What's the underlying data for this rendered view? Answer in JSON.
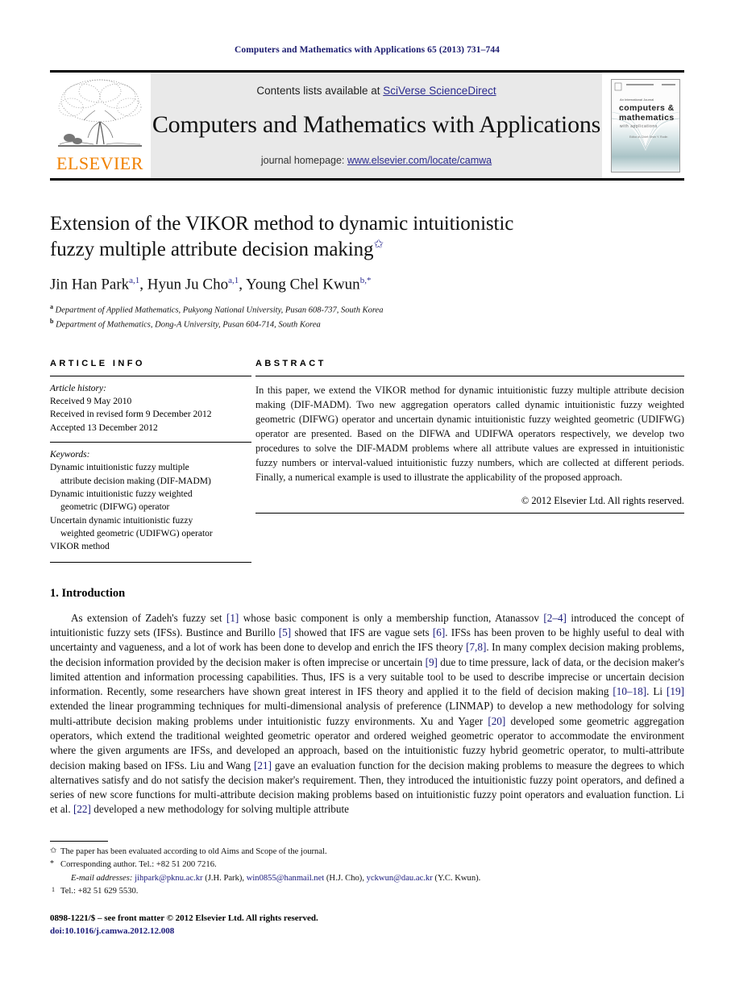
{
  "running_head": "Computers and Mathematics with Applications 65 (2013) 731–744",
  "masthead": {
    "publisher_word": "ELSEVIER",
    "contents_prefix": "Contents lists available at ",
    "contents_link": "SciVerse ScienceDirect",
    "journal_title": "Computers and Mathematics with Applications",
    "homepage_prefix": "journal homepage: ",
    "homepage_link": "www.elsevier.com/locate/camwa",
    "cover": {
      "top_label": "An International Journal",
      "line1": "computers &",
      "line2": "mathematics",
      "line3": "with applications",
      "editor": "Editor-in-Chief: Ervin Y. Rodin"
    }
  },
  "title": {
    "line1": "Extension of the VIKOR method to dynamic intuitionistic",
    "line2": "fuzzy multiple attribute decision making",
    "star": "✩"
  },
  "authors": {
    "a1": "Jin Han Park",
    "a1_sup": "a,1",
    "a2": "Hyun Ju Cho",
    "a2_sup": "a,1",
    "a3": "Young Chel Kwun",
    "a3_sup": "b,*"
  },
  "affiliations": [
    {
      "mark": "a",
      "text": "Department of Applied Mathematics, Pukyong National University, Pusan 608-737, South Korea"
    },
    {
      "mark": "b",
      "text": "Department of Mathematics, Dong-A University, Pusan 604-714, South Korea"
    }
  ],
  "article_info": {
    "heading": "ARTICLE INFO",
    "history_label": "Article history:",
    "history": [
      "Received 9 May 2010",
      "Received in revised form 9 December 2012",
      "Accepted 13 December 2012"
    ],
    "keywords_label": "Keywords:",
    "keywords": [
      {
        "main": "Dynamic intuitionistic fuzzy multiple",
        "cont": "attribute decision making (DIF-MADM)"
      },
      {
        "main": "Dynamic intuitionistic fuzzy weighted",
        "cont": "geometric (DIFWG) operator"
      },
      {
        "main": "Uncertain dynamic intuitionistic fuzzy",
        "cont": "weighted geometric (UDIFWG) operator"
      },
      {
        "main": "VIKOR method",
        "cont": ""
      }
    ]
  },
  "abstract": {
    "heading": "ABSTRACT",
    "text": "In this paper, we extend the VIKOR method for dynamic intuitionistic fuzzy multiple attribute decision making (DIF-MADM). Two new aggregation operators called dynamic intuitionistic fuzzy weighted geometric (DIFWG) operator and uncertain dynamic intuitionistic fuzzy weighted geometric (UDIFWG) operator are presented. Based on the DIFWA and UDIFWA operators respectively, we develop two procedures to solve the DIF-MADM problems where all attribute values are expressed in intuitionistic fuzzy numbers or interval-valued intuitionistic fuzzy numbers, which are collected at different periods. Finally, a numerical example is used to illustrate the applicability of the proposed approach.",
    "copyright": "© 2012 Elsevier Ltd. All rights reserved."
  },
  "introduction": {
    "section_number": "1.",
    "section_title": "Introduction",
    "paragraph_html": "As extension of Zadeh's fuzzy set <span class=\"ref\">[1]</span> whose basic component is only a membership function, Atanassov <span class=\"ref\">[2–4]</span> introduced the concept of intuitionistic fuzzy sets (IFSs). Bustince and Burillo <span class=\"ref\">[5]</span> showed that IFS are vague sets <span class=\"ref\">[6]</span>. IFSs has been proven to be highly useful to deal with uncertainty and vagueness, and a lot of work has been done to develop and enrich the IFS theory <span class=\"ref\">[7,8]</span>. In many complex decision making problems, the decision information provided by the decision maker is often imprecise or uncertain <span class=\"ref\">[9]</span> due to time pressure, lack of data, or the decision maker's limited attention and information processing capabilities. Thus, IFS is a very suitable tool to be used to describe imprecise or uncertain decision information. Recently, some researchers have shown great interest in IFS theory and applied it to the field of decision making <span class=\"ref\">[10–18]</span>. Li <span class=\"ref\">[19]</span> extended the linear programming techniques for multi-dimensional analysis of preference (LINMAP) to develop a new methodology for solving multi-attribute decision making problems under intuitionistic fuzzy environments. Xu and Yager <span class=\"ref\">[20]</span> developed some geometric aggregation operators, which extend the traditional weighted geometric operator and ordered weighed geometric operator to accommodate the environment where the given arguments are IFSs, and developed an approach, based on the intuitionistic fuzzy hybrid geometric operator, to multi-attribute decision making based on IFSs. Liu and Wang <span class=\"ref\">[21]</span> gave an evaluation function for the decision making problems to measure the degrees to which alternatives satisfy and do not satisfy the decision maker's requirement. Then, they introduced the intuitionistic fuzzy point operators, and defined a series of new score functions for multi-attribute decision making problems based on intuitionistic fuzzy point operators and evaluation function. Li et al. <span class=\"ref\">[22]</span> developed a new methodology for solving multiple attribute"
  },
  "footnotes": {
    "note_star_open": "✩",
    "note_star_text": "The paper has been evaluated according to old Aims and Scope of the journal.",
    "note_asterisk": "*",
    "note_asterisk_text": "Corresponding author. Tel.: +82 51 200 7216.",
    "email_label": "E-mail addresses:",
    "emails_html": "<span class=\"fn-mail\">jihpark@pknu.ac.kr</span> (J.H. Park), <span class=\"fn-mail\">win0855@hanmail.net</span> (H.J. Cho), <span class=\"fn-mail\">yckwun@dau.ac.kr</span> (Y.C. Kwun).",
    "note_one": "1",
    "note_one_text": "Tel.: +82 51 629 5530.",
    "issn_line": "0898-1221/$ – see front matter © 2012 Elsevier Ltd. All rights reserved.",
    "doi_line": "doi:10.1016/j.camwa.2012.12.008"
  },
  "colors": {
    "running_head": "#1a1a6e",
    "link": "#2b2b8f",
    "elsevier_orange": "#F08000",
    "masthead_bg": "#e9e9e9",
    "reference": "#1a1a7a"
  }
}
